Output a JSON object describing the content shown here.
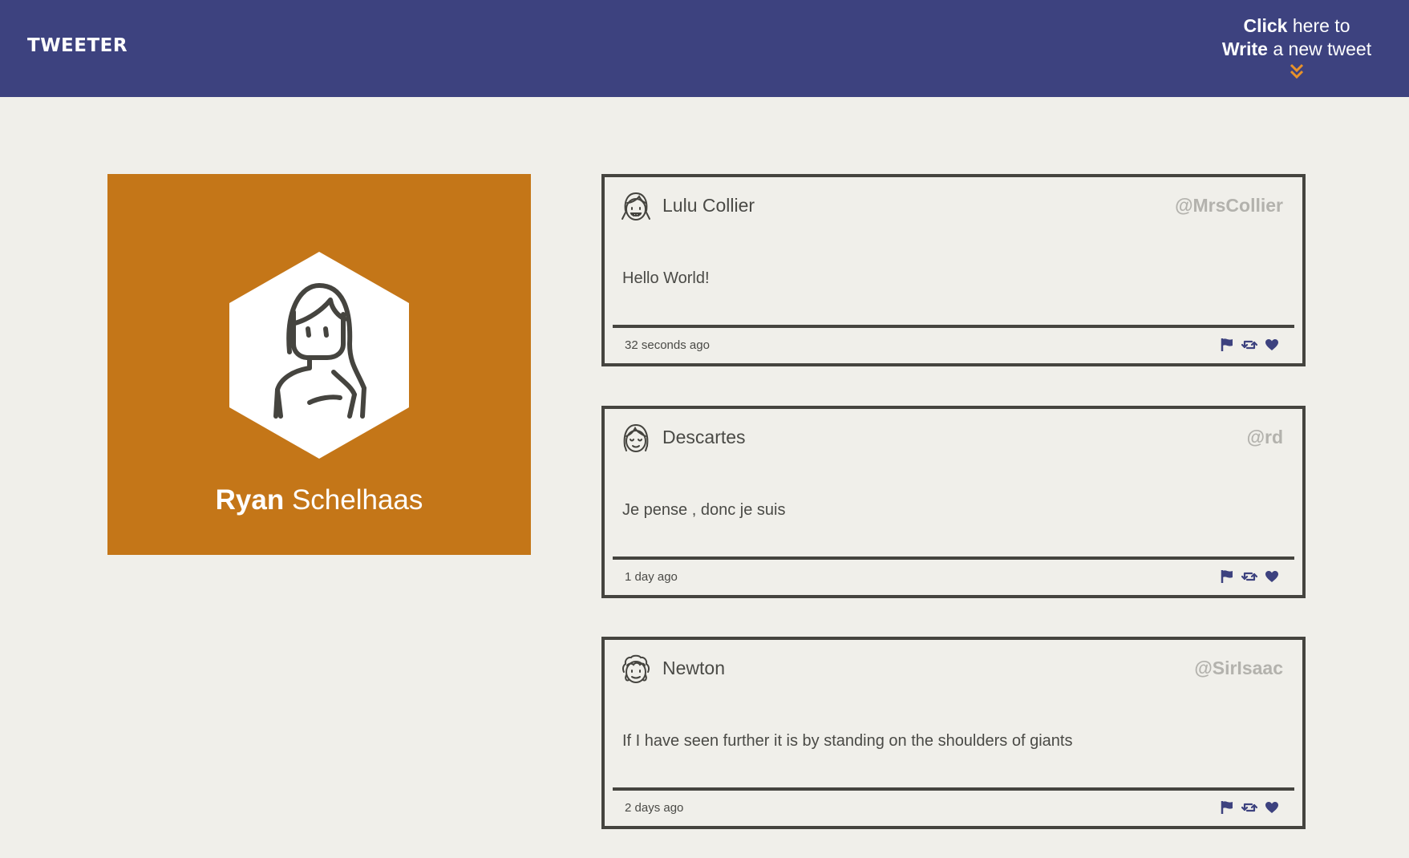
{
  "nav": {
    "logo": "TWEETER",
    "compose": {
      "click": "Click",
      "here_to": "here to",
      "write": "Write",
      "new_tweet": "a new tweet"
    }
  },
  "profile": {
    "first_name": "Ryan",
    "last_name": "Schelhaas"
  },
  "tweets": [
    {
      "name": "Lulu Collier",
      "handle": "@MrsCollier",
      "text": "Hello World!",
      "time": "32 seconds ago"
    },
    {
      "name": "Descartes",
      "handle": "@rd",
      "text": "Je pense , donc je suis",
      "time": "1 day ago"
    },
    {
      "name": "Newton",
      "handle": "@SirIsaac",
      "text": "If I have seen further it is by standing on the shoulders of giants",
      "time": "2 days ago"
    }
  ],
  "colors": {
    "nav_background": "#3d427f",
    "profile_background": "#c47618",
    "page_background": "#f0efea",
    "accent_arrow": "#e8922a",
    "action_icons": "#3d427f",
    "tweet_border": "#45443f",
    "handle_text": "#b3b2ad"
  },
  "icons": {
    "compose_arrow": "double-chevron-down-icon",
    "flag": "flag-icon",
    "retweet": "retweet-icon",
    "like": "heart-icon"
  }
}
